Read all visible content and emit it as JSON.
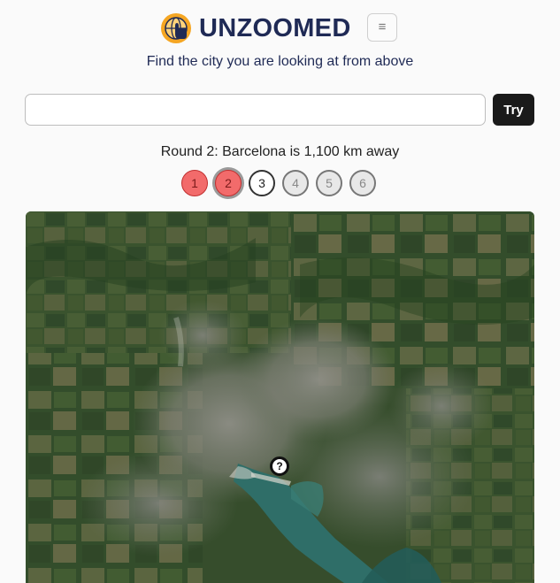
{
  "header": {
    "brand": "UNZOOMED",
    "logo_icon": "globe-hand-icon",
    "menu_icon": "≡",
    "tagline": "Find the city you are looking at from above"
  },
  "guess": {
    "input_value": "",
    "try_label": "Try"
  },
  "round": {
    "status": "Round 2: Barcelona is 1,100 km away",
    "dots": [
      {
        "label": "1",
        "state": "wrong"
      },
      {
        "label": "2",
        "state": "current-wrong"
      },
      {
        "label": "3",
        "state": "current"
      },
      {
        "label": "4",
        "state": "future"
      },
      {
        "label": "5",
        "state": "future"
      },
      {
        "label": "6",
        "state": "future"
      }
    ]
  },
  "map": {
    "marker_label": "?",
    "marker_icon": "question-marker-icon"
  },
  "colors": {
    "brand": "#1f2a55",
    "wrong": "#f26b6b",
    "logo_orange": "#f5a623"
  }
}
